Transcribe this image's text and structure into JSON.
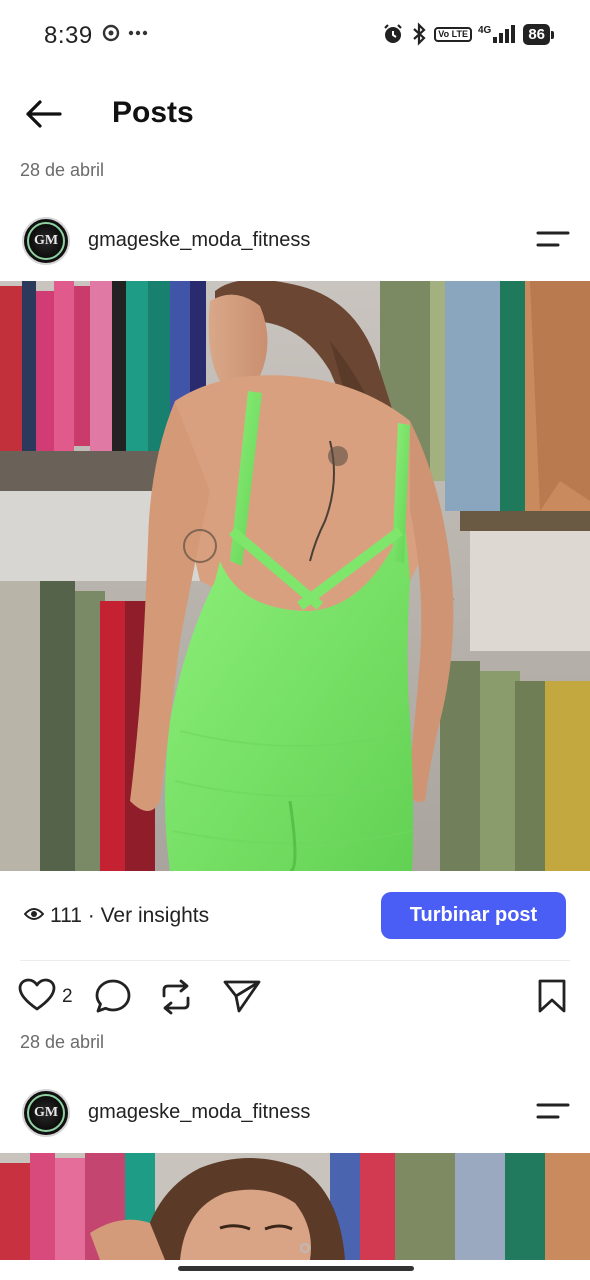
{
  "status": {
    "time": "8:39",
    "network": "4G",
    "volte": "Vo LTE",
    "battery": "86"
  },
  "header": {
    "title": "Posts"
  },
  "posts": [
    {
      "date": "28 de abril",
      "username": "gmageske_moda_fitness",
      "avatar_text": "GM",
      "views": "111 · Ver insights",
      "boost_label": "Turbinar post",
      "likes": "2"
    },
    {
      "date": "28 de abril",
      "username": "gmageske_moda_fitness",
      "avatar_text": "GM"
    }
  ],
  "colors": {
    "accent": "#4a5ef5",
    "jumpsuit": "#7be86a"
  },
  "icons": [
    "back-arrow-icon",
    "more-menu-icon",
    "eye-icon",
    "heart-icon",
    "comment-icon",
    "repost-icon",
    "share-icon",
    "bookmark-icon"
  ]
}
